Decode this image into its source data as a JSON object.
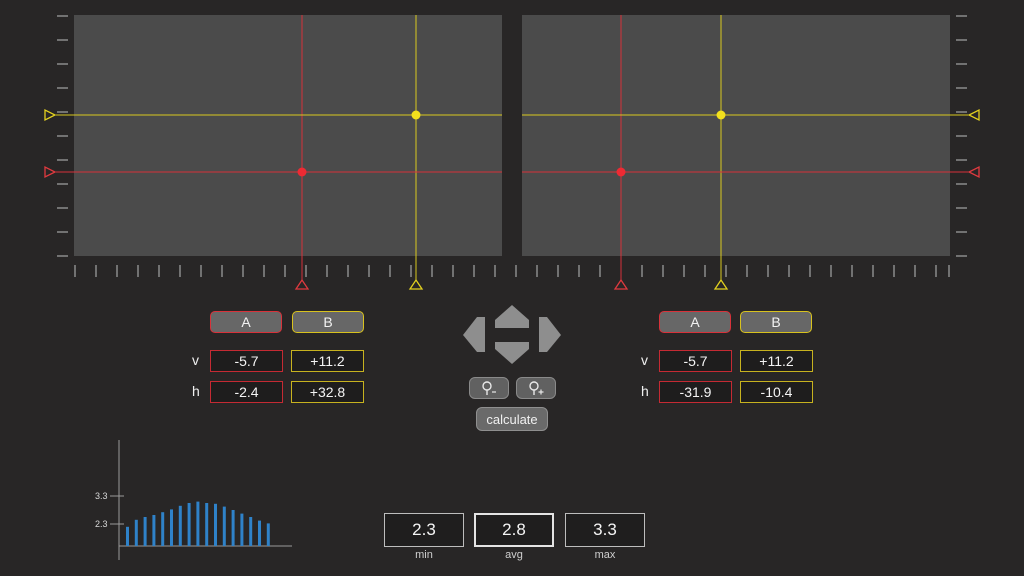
{
  "left_panel": {
    "buttons": {
      "a": "A",
      "b": "B"
    },
    "row_v_label": "v",
    "row_h_label": "h",
    "a_v": "-5.7",
    "b_v": "+11.2",
    "a_h": "-2.4",
    "b_h": "+32.8"
  },
  "right_panel": {
    "buttons": {
      "a": "A",
      "b": "B"
    },
    "row_v_label": "v",
    "row_h_label": "h",
    "a_v": "-5.7",
    "b_v": "+11.2",
    "a_h": "-31.9",
    "b_h": "-10.4"
  },
  "controls": {
    "calculate_label": "calculate",
    "icons": [
      "arrow-up-icon",
      "arrow-down-icon",
      "arrow-left-icon",
      "arrow-right-icon",
      "zoom-out-icon",
      "zoom-in-icon"
    ]
  },
  "stats": {
    "min_value": "2.3",
    "min_label": "min",
    "avg_value": "2.8",
    "avg_label": "avg",
    "max_value": "3.3",
    "max_label": "max"
  },
  "colors": {
    "marker_a": "#e03a3f",
    "marker_b": "#e7d526",
    "bars": "#2f82c9",
    "view_bg": "#4b4b4b"
  },
  "chart_data": {
    "type": "bar",
    "tick_labels": [
      "3.3",
      "2.3"
    ],
    "yticks": [
      3.3,
      2.3
    ],
    "ylim": [
      1.4,
      3.85
    ],
    "values": [
      2.2,
      2.45,
      2.55,
      2.62,
      2.72,
      2.82,
      2.95,
      3.05,
      3.1,
      3.05,
      3.02,
      2.92,
      2.8,
      2.67,
      2.55,
      2.42,
      2.32
    ]
  }
}
